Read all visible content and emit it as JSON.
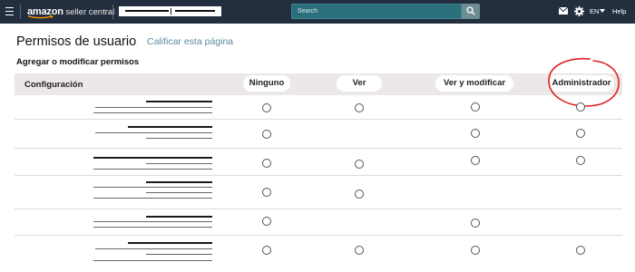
{
  "header": {
    "logo_brand": "amazon",
    "logo_rest": " seller central",
    "search_placeholder": "Search",
    "language": "EN",
    "help": "Help",
    "icons": [
      "menu-icon",
      "mail-icon",
      "gear-icon",
      "chevron-down-icon",
      "search-icon"
    ],
    "colors": {
      "bar": "#232f3e",
      "search": "#2c6f7c",
      "search_button": "#6d8d95"
    }
  },
  "page": {
    "title": "Permisos de usuario",
    "rate_link": "Calificar esta página",
    "section_title": "Agregar o modificar permisos"
  },
  "table": {
    "columns": [
      "Configuración",
      "Ninguno",
      "Ver",
      "Ver y modificar",
      "Administrador"
    ],
    "rows": [
      {
        "ninguno": true,
        "ver": true,
        "ver_y_modificar": true,
        "administrador": true
      },
      {
        "ninguno": true,
        "ver": false,
        "ver_y_modificar": true,
        "administrador": true
      },
      {
        "ninguno": true,
        "ver": true,
        "ver_y_modificar": true,
        "administrador": true
      },
      {
        "ninguno": true,
        "ver": true,
        "ver_y_modificar": false,
        "administrador": false
      },
      {
        "ninguno": true,
        "ver": false,
        "ver_y_modificar": true,
        "administrador": false
      },
      {
        "ninguno": true,
        "ver": true,
        "ver_y_modificar": true,
        "administrador": true
      }
    ]
  },
  "annotation": {
    "circled_column": "Administrador",
    "color": "#e02020"
  }
}
